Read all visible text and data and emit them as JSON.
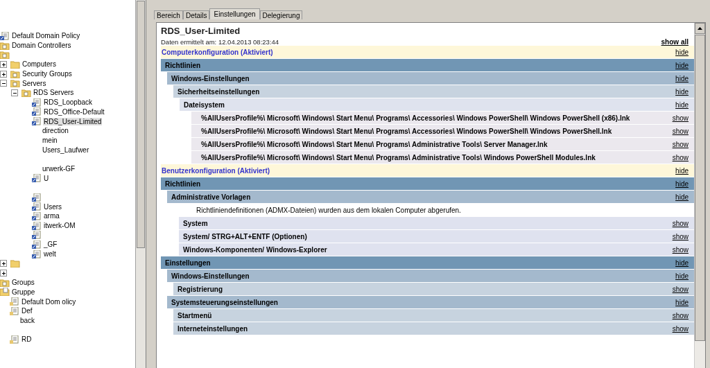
{
  "tree": [
    {
      "kind": "gpo",
      "text": "Default Domain Policy"
    },
    {
      "kind": "ou",
      "text": "Domain Controllers"
    },
    {
      "kind": "ou",
      "children": [
        {
          "kind": "folder",
          "text": "Computers",
          "expanded": false
        },
        {
          "kind": "ou",
          "text": "Security Groups",
          "expanded": false
        },
        {
          "kind": "ou",
          "text": "Servers",
          "expanded": true,
          "children": [
            {
              "kind": "ou",
              "text": "RDS Servers",
              "expanded": true,
              "children": [
                {
                  "kind": "gpo",
                  "text": "RDS_Loopback",
                  "selected": false
                },
                {
                  "kind": "gpo",
                  "text": "RDS_Office-Default",
                  "selected": false
                },
                {
                  "kind": "gpo",
                  "text": "RDS_User-Limited",
                  "selected": true
                },
                {
                  "kind": "blank",
                  "text": "direction"
                },
                {
                  "kind": "blank",
                  "text": "mein"
                },
                {
                  "kind": "blank",
                  "text": "Users_Laufwer"
                },
                {
                  "kind": "blank"
                },
                {
                  "kind": "blank",
                  "text": "urwerk-GF"
                },
                {
                  "kind": "gpo",
                  "text": "U"
                },
                {
                  "kind": "blank"
                },
                {
                  "kind": "gpo"
                },
                {
                  "kind": "gpo",
                  "text": "Users"
                },
                {
                  "kind": "gpo",
                  "text": "arma"
                },
                {
                  "kind": "gpo",
                  "text": "itwerk-OM"
                },
                {
                  "kind": "gpo"
                },
                {
                  "kind": "gpo",
                  "text": "_GF"
                },
                {
                  "kind": "gpo",
                  "text": "welt"
                }
              ]
            }
          ]
        },
        {
          "kind": "folder",
          "expanded": false
        },
        {
          "kind": "blank",
          "expanded": false
        }
      ]
    },
    {
      "kind": "ou",
      "text": "Groups"
    },
    {
      "kind": "gpo-folder",
      "text": "Gruppe",
      "children": [
        {
          "kind": "gpo-plain",
          "text": "Default Dom olicy"
        },
        {
          "kind": "gpo-plain",
          "text": "Def"
        },
        {
          "kind": "blank",
          "text": "back"
        },
        {
          "kind": "blank"
        },
        {
          "kind": "gpo-plain",
          "text": "RD"
        }
      ]
    }
  ],
  "tabs": [
    {
      "label": "Bereich",
      "selected": false
    },
    {
      "label": "Details",
      "selected": false
    },
    {
      "label": "Einstellungen",
      "selected": true
    },
    {
      "label": "Delegierung",
      "selected": false
    }
  ],
  "report": {
    "title": "RDS_User-Limited",
    "subtitle": "Daten ermittelt am: 12.04.2013 08:23:44",
    "show_all": "show all",
    "rows": [
      {
        "kind": "section",
        "text": "Computerkonfiguration (Aktiviert)",
        "toggle": "hide",
        "children": [
          {
            "kind": "group",
            "text": "Richtlinien",
            "toggle": "hide",
            "children": [
              {
                "kind": "group",
                "text": "Windows-Einstellungen",
                "toggle": "hide",
                "children": [
                  {
                    "kind": "group",
                    "text": "Sicherheitseinstellungen",
                    "toggle": "hide",
                    "children": [
                      {
                        "kind": "group",
                        "text": "Dateisystem",
                        "toggle": "hide",
                        "children": [
                          {
                            "kind": "file",
                            "text": "%AllUsersProfile%\\ Microsoft\\ Windows\\ Start Menu\\ Programs\\ Accessories\\ Windows PowerShell\\ Windows PowerShell (x86).lnk",
                            "toggle": "show"
                          },
                          {
                            "kind": "file",
                            "text": "%AllUsersProfile%\\ Microsoft\\ Windows\\ Start Menu\\ Programs\\ Accessories\\ Windows PowerShell\\ Windows PowerShell.lnk",
                            "toggle": "show"
                          },
                          {
                            "kind": "file",
                            "text": "%AllUsersProfile%\\ Microsoft\\ Windows\\ Start Menu\\ Programs\\ Administrative Tools\\ Server Manager.lnk",
                            "toggle": "show"
                          },
                          {
                            "kind": "file",
                            "text": "%AllUsersProfile%\\ Microsoft\\ Windows\\ Start Menu\\ Programs\\ Administrative Tools\\ Windows PowerShell Modules.lnk",
                            "toggle": "show"
                          }
                        ]
                      }
                    ]
                  }
                ]
              }
            ]
          }
        ]
      },
      {
        "kind": "section",
        "text": "Benutzerkonfiguration (Aktiviert)",
        "toggle": "hide",
        "children": [
          {
            "kind": "group",
            "text": "Richtlinien",
            "toggle": "hide",
            "children": [
              {
                "kind": "group",
                "text": "Administrative Vorlagen",
                "toggle": "hide",
                "children": [
                  {
                    "kind": "note",
                    "text": "Richtliniendefinitionen (ADMX-Dateien) wurden aus dem lokalen Computer abgerufen."
                  },
                  {
                    "kind": "item",
                    "text": "System",
                    "toggle": "show"
                  },
                  {
                    "kind": "item",
                    "text": "System/ STRG+ALT+ENTF (Optionen)",
                    "toggle": "show"
                  },
                  {
                    "kind": "item",
                    "text": "Windows-Komponenten/ Windows-Explorer",
                    "toggle": "show"
                  }
                ]
              }
            ]
          },
          {
            "kind": "group",
            "text": "Einstellungen",
            "toggle": "hide",
            "children": [
              {
                "kind": "group",
                "text": "Windows-Einstellungen",
                "toggle": "hide",
                "children": [
                  {
                    "kind": "group",
                    "text": "Registrierung",
                    "toggle": "show"
                  }
                ]
              },
              {
                "kind": "group",
                "text": "Systemsteuerungseinstellungen",
                "toggle": "hide",
                "children": [
                  {
                    "kind": "group",
                    "text": "Startmenü",
                    "toggle": "show"
                  },
                  {
                    "kind": "group",
                    "text": "Interneteinstellungen",
                    "toggle": "show"
                  }
                ]
              }
            ]
          }
        ]
      }
    ]
  }
}
